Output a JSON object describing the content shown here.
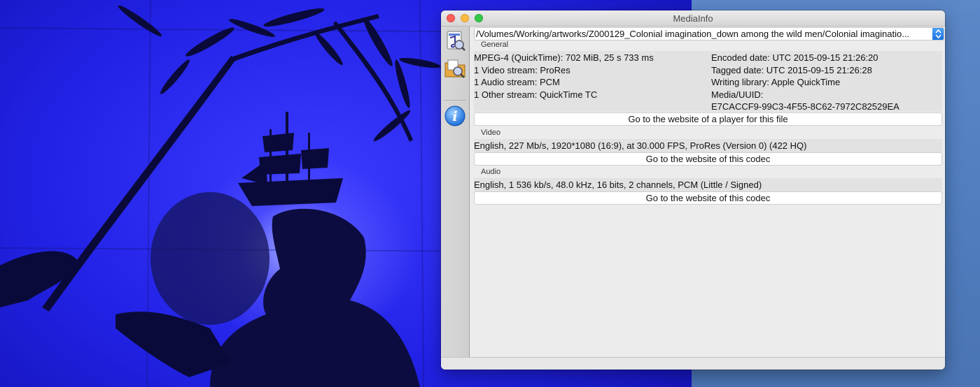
{
  "window": {
    "title": "MediaInfo"
  },
  "file": {
    "path": "/Volumes/Working/artworks/Z000129_Colonial imagination_down among the wild men/Colonial imaginatio..."
  },
  "sidebar": {
    "items": [
      {
        "icon": "file-open-icon"
      },
      {
        "icon": "folder-open-icon"
      },
      {
        "icon": "info-icon",
        "label": "i"
      }
    ]
  },
  "general": {
    "label": "General",
    "left": [
      "MPEG-4 (QuickTime): 702 MiB, 25 s 733 ms",
      "1 Video stream: ProRes",
      "1 Audio stream: PCM",
      "1 Other stream: QuickTime TC"
    ],
    "right": [
      "Encoded date: UTC 2015-09-15 21:26:20",
      "Tagged date: UTC 2015-09-15 21:26:28",
      "Writing library: Apple QuickTime",
      "Media/UUID:",
      "E7CACCF9-99C3-4F55-8C62-7972C82529EA"
    ],
    "button": "Go to the website of a player for this file"
  },
  "video": {
    "label": "Video",
    "line": "English, 227 Mb/s, 1920*1080 (16:9), at 30.000 FPS, ProRes (Version 0) (422 HQ)",
    "button": "Go to the website of this codec"
  },
  "audio": {
    "label": "Audio",
    "line": "English, 1 536 kb/s, 48.0 kHz, 16 bits, 2 channels, PCM (Little / Signed)",
    "button": "Go to the website of this codec"
  },
  "colors": {
    "desktop": "#5a86c4",
    "video_blue": "#2222e6",
    "accent": "#1a6fe0"
  }
}
